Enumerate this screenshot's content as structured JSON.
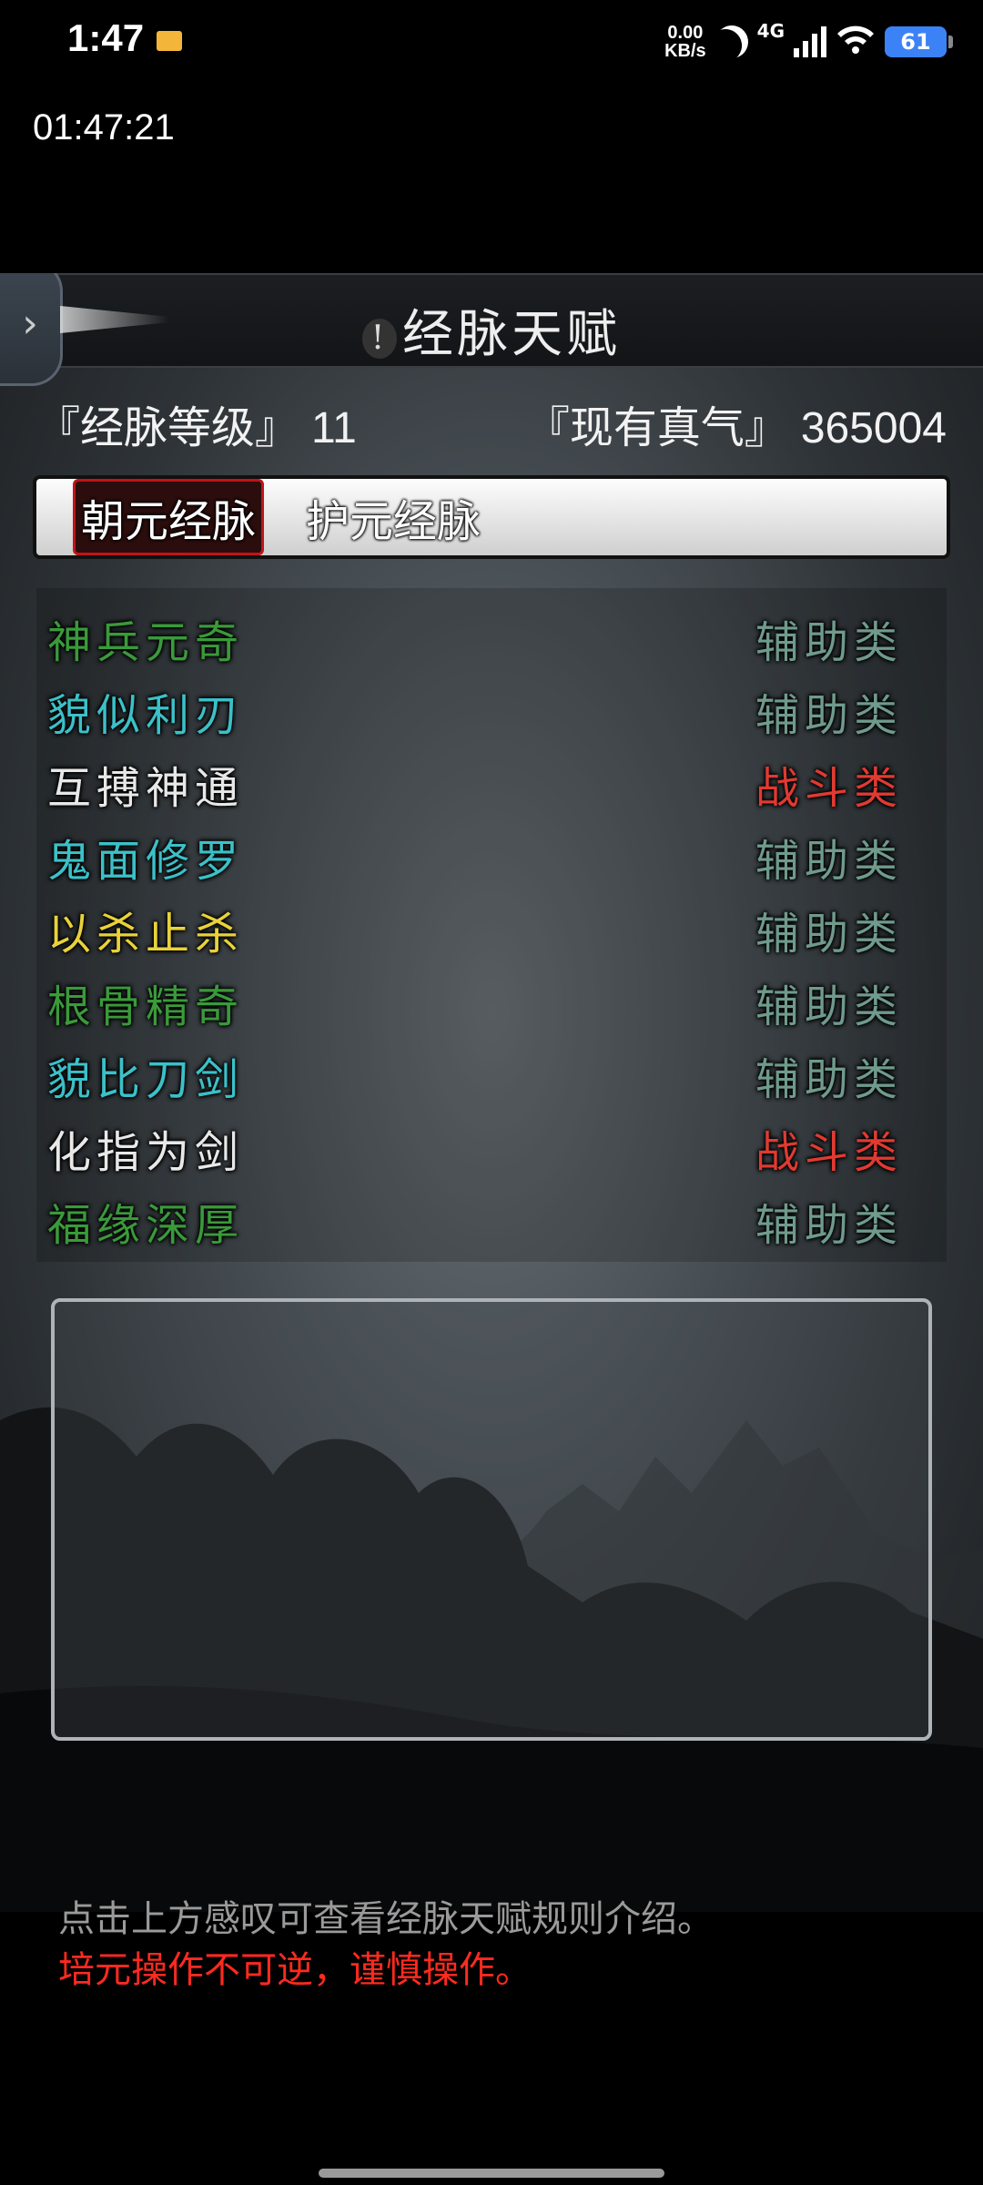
{
  "status_bar": {
    "time": "1:47",
    "net_speed_value": "0.00",
    "net_speed_unit": "KB/s",
    "network": "4G",
    "battery": "61",
    "icons": [
      "mail-icon",
      "moon-icon",
      "signal-icon",
      "wifi-icon",
      "battery-icon"
    ]
  },
  "clock": "01:47:21",
  "header": {
    "info_mark": "!",
    "title": "经脉天赋",
    "back_icon": "chevron-right-icon"
  },
  "stats": {
    "level_label": "『经脉等级』",
    "level_value": "11",
    "qi_label": "『现有真气』",
    "qi_value": "365004"
  },
  "tabs": [
    {
      "label": "朝元经脉",
      "active": true
    },
    {
      "label": "护元经脉",
      "active": false
    }
  ],
  "talents": [
    {
      "name": "神兵元奇",
      "type": "辅助类",
      "name_color": "#3a9a3a",
      "type_color": "#6f9a8c"
    },
    {
      "name": "貌似利刃",
      "type": "辅助类",
      "name_color": "#3cc0c8",
      "type_color": "#6f9a8c"
    },
    {
      "name": "互搏神通",
      "type": "战斗类",
      "name_color": "#e8e8e8",
      "type_color": "#e03a32"
    },
    {
      "name": "鬼面修罗",
      "type": "辅助类",
      "name_color": "#3cc0c8",
      "type_color": "#6f9a8c"
    },
    {
      "name": "以杀止杀",
      "type": "辅助类",
      "name_color": "#e8d23a",
      "type_color": "#6f9a8c"
    },
    {
      "name": "根骨精奇",
      "type": "辅助类",
      "name_color": "#3a9a3a",
      "type_color": "#6f9a8c"
    },
    {
      "name": "貌比刀剑",
      "type": "辅助类",
      "name_color": "#3cc0c8",
      "type_color": "#6f9a8c"
    },
    {
      "name": "化指为剑",
      "type": "战斗类",
      "name_color": "#e8e8e8",
      "type_color": "#e03a32"
    },
    {
      "name": "福缘深厚",
      "type": "辅助类",
      "name_color": "#3a9a3a",
      "type_color": "#6f9a8c"
    }
  ],
  "notes": {
    "hint": "点击上方感叹可查看经脉天赋规则介绍。",
    "warning": "培元操作不可逆，谨慎操作。"
  }
}
